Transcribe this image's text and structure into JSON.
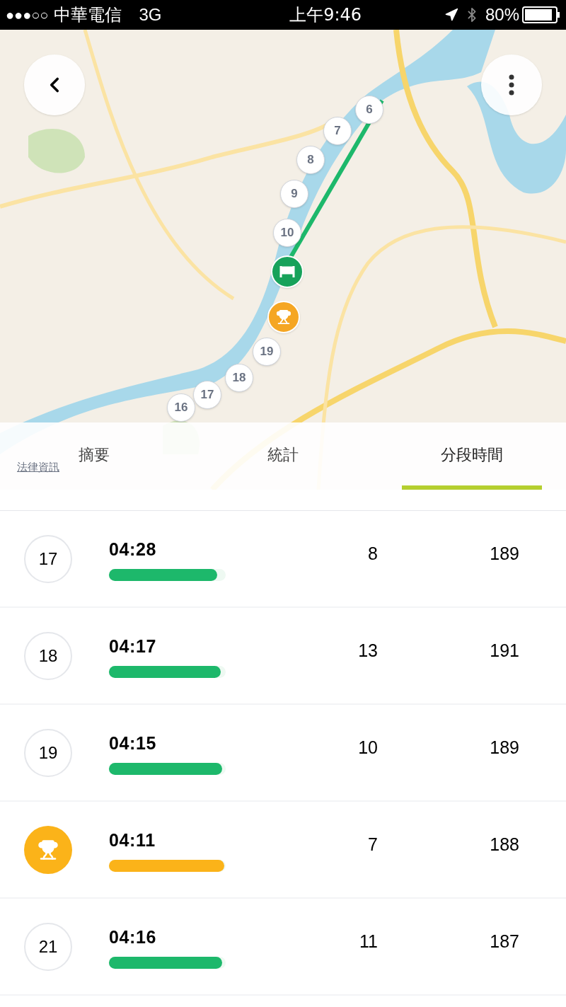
{
  "status_bar": {
    "signal": "●●●○○",
    "carrier": "中華電信",
    "network": "3G",
    "time": "上午9:46",
    "battery": "80%"
  },
  "map": {
    "kind": "picture",
    "pins": [
      {
        "kind": "split",
        "label": "6"
      },
      {
        "kind": "split",
        "label": "7"
      },
      {
        "kind": "split",
        "label": "8"
      },
      {
        "kind": "split",
        "label": "9"
      },
      {
        "kind": "split",
        "label": "10"
      },
      {
        "kind": "finish"
      },
      {
        "kind": "best"
      },
      {
        "kind": "split",
        "label": "19"
      },
      {
        "kind": "split",
        "label": "18"
      },
      {
        "kind": "split",
        "label": "17"
      },
      {
        "kind": "split",
        "label": "16"
      }
    ],
    "legal_link": "法律資訊"
  },
  "tabs": [
    {
      "label": "摘要",
      "selected": false
    },
    {
      "label": "統計",
      "selected": false
    },
    {
      "label": "分段時間",
      "selected": true
    }
  ],
  "splits": [
    {
      "kind": "split",
      "number": "17",
      "time": "04:28",
      "level": 0.93,
      "column_3": "8",
      "column_4": "189"
    },
    {
      "kind": "split",
      "number": "18",
      "time": "04:17",
      "level": 0.96,
      "column_3": "13",
      "column_4": "191"
    },
    {
      "kind": "split",
      "number": "19",
      "time": "04:15",
      "level": 0.97,
      "column_3": "10",
      "column_4": "189"
    },
    {
      "kind": "best",
      "time": "04:11",
      "level": 0.99,
      "column_3": "7",
      "column_4": "188"
    },
    {
      "kind": "split",
      "number": "21",
      "time": "04:16",
      "level": 0.97,
      "column_3": "11",
      "column_4": "187"
    }
  ]
}
